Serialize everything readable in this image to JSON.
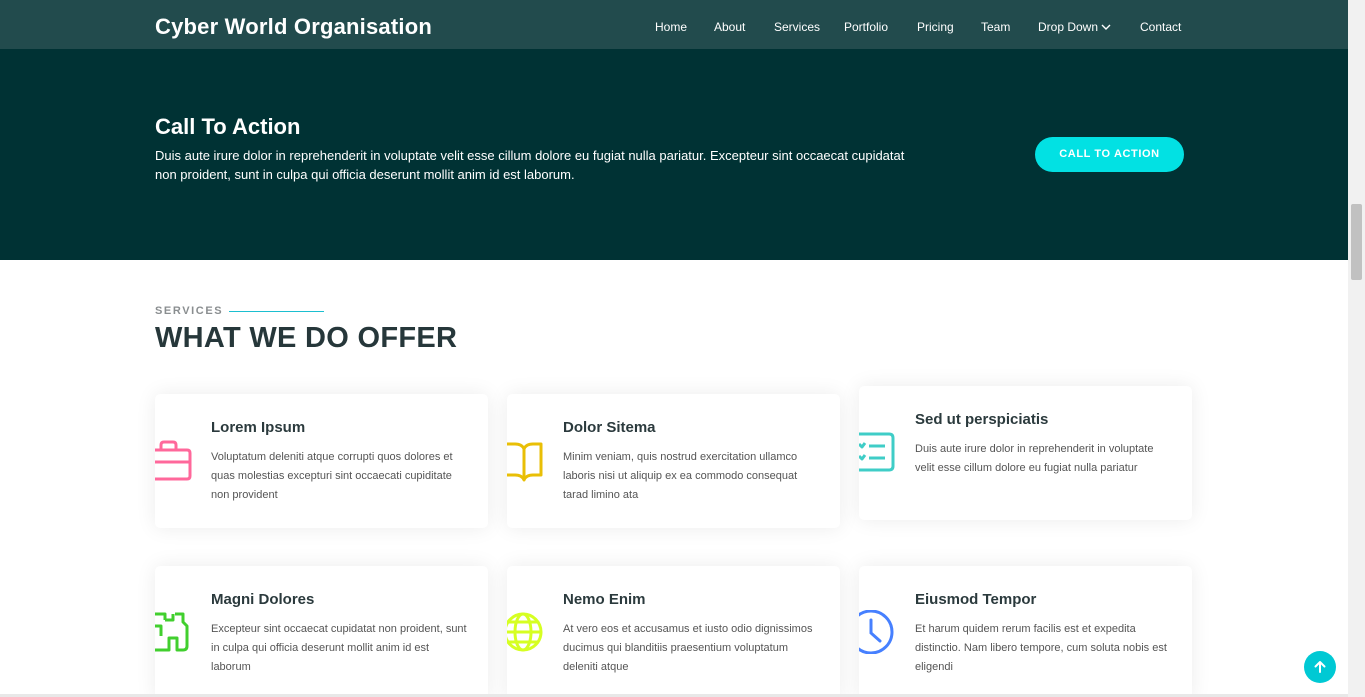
{
  "header": {
    "logo": "Cyber World Organisation",
    "nav": [
      {
        "label": "Home"
      },
      {
        "label": "About"
      },
      {
        "label": "Services"
      },
      {
        "label": "Portfolio"
      },
      {
        "label": "Pricing"
      },
      {
        "label": "Team"
      },
      {
        "label": "Drop Down"
      },
      {
        "label": "Contact"
      }
    ]
  },
  "cta": {
    "title": "Call To Action",
    "text": "Duis aute irure dolor in reprehenderit in voluptate velit esse cillum dolore eu fugiat nulla pariatur. Excepteur sint occaecat cupidatat non proident, sunt in culpa qui officia deserunt mollit anim id est laborum.",
    "button": "CALL TO ACTION"
  },
  "services": {
    "label": "SERVICES",
    "title": "WHAT WE DO OFFER",
    "cards": [
      {
        "title": "Lorem Ipsum",
        "desc": "Voluptatum deleniti atque corrupti quos dolores et quas molestias excepturi sint occaecati cupiditate non provident",
        "icon": "briefcase-icon",
        "color": "#ff689b"
      },
      {
        "title": "Dolor Sitema",
        "desc": "Minim veniam, quis nostrud exercitation ullamco laboris nisi ut aliquip ex ea commodo consequat tarad limino ata",
        "icon": "book-icon",
        "color": "#e9bf06"
      },
      {
        "title": "Sed ut perspiciatis",
        "desc": "Duis aute irure dolor in reprehenderit in voluptate velit esse cillum dolore eu fugiat nulla pariatur",
        "icon": "card-checklist-icon",
        "color": "#3fcdc7"
      },
      {
        "title": "Magni Dolores",
        "desc": "Excepteur sint occaecat cupidatat non proident, sunt in culpa qui officia deserunt mollit anim id est laborum",
        "icon": "binoculars-icon",
        "color": "#41cf2e"
      },
      {
        "title": "Nemo Enim",
        "desc": "At vero eos et accusamus et iusto odio dignissimos ducimus qui blanditiis praesentium voluptatum deleniti atque",
        "icon": "globe-icon",
        "color": "#d6ff22"
      },
      {
        "title": "Eiusmod Tempor",
        "desc": "Et harum quidem rerum facilis est et expedita distinctio. Nam libero tempore, cum soluta nobis est eligendi",
        "icon": "clock-icon",
        "color": "#4680ff"
      }
    ]
  },
  "colors": {
    "header_bg": "#224b4d",
    "cta_bg": "#003234",
    "accent": "#02e1e3"
  }
}
